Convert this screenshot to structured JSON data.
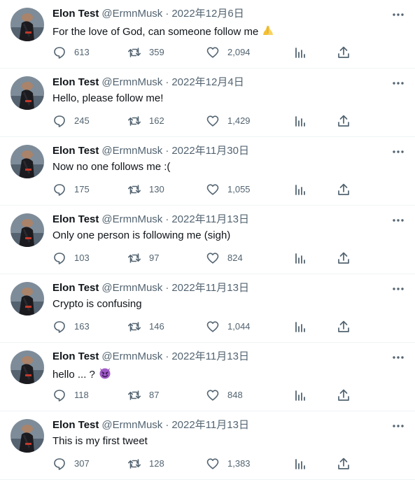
{
  "colors": {
    "text_primary": "#0f1419",
    "text_secondary": "#536471",
    "divider": "#eff3f4",
    "background": "#ffffff"
  },
  "tweets": [
    {
      "name": "Elon Test",
      "handle": "@ErmnMusk",
      "separator": "·",
      "date": "2022年12月6日",
      "text": "For the love of God, can someone follow me",
      "emoji": "praying-hands",
      "replies": "613",
      "retweets": "359",
      "likes": "2,094"
    },
    {
      "name": "Elon Test",
      "handle": "@ErmnMusk",
      "separator": "·",
      "date": "2022年12月4日",
      "text": "Hello, please follow me!",
      "emoji": "",
      "replies": "245",
      "retweets": "162",
      "likes": "1,429"
    },
    {
      "name": "Elon Test",
      "handle": "@ErmnMusk",
      "separator": "·",
      "date": "2022年11月30日",
      "text": "Now no one follows me :(",
      "emoji": "",
      "replies": "175",
      "retweets": "130",
      "likes": "1,055"
    },
    {
      "name": "Elon Test",
      "handle": "@ErmnMusk",
      "separator": "·",
      "date": "2022年11月13日",
      "text": "Only one person is following me (sigh)",
      "emoji": "",
      "replies": "103",
      "retweets": "97",
      "likes": "824"
    },
    {
      "name": "Elon Test",
      "handle": "@ErmnMusk",
      "separator": "·",
      "date": "2022年11月13日",
      "text": "Crypto is confusing",
      "emoji": "",
      "replies": "163",
      "retweets": "146",
      "likes": "1,044"
    },
    {
      "name": "Elon Test",
      "handle": "@ErmnMusk",
      "separator": "·",
      "date": "2022年11月13日",
      "text": "hello ... ?",
      "emoji": "smiling-devil",
      "replies": "118",
      "retweets": "87",
      "likes": "848"
    },
    {
      "name": "Elon Test",
      "handle": "@ErmnMusk",
      "separator": "·",
      "date": "2022年11月13日",
      "text": "This is my first tweet",
      "emoji": "",
      "replies": "307",
      "retweets": "128",
      "likes": "1,383"
    }
  ]
}
